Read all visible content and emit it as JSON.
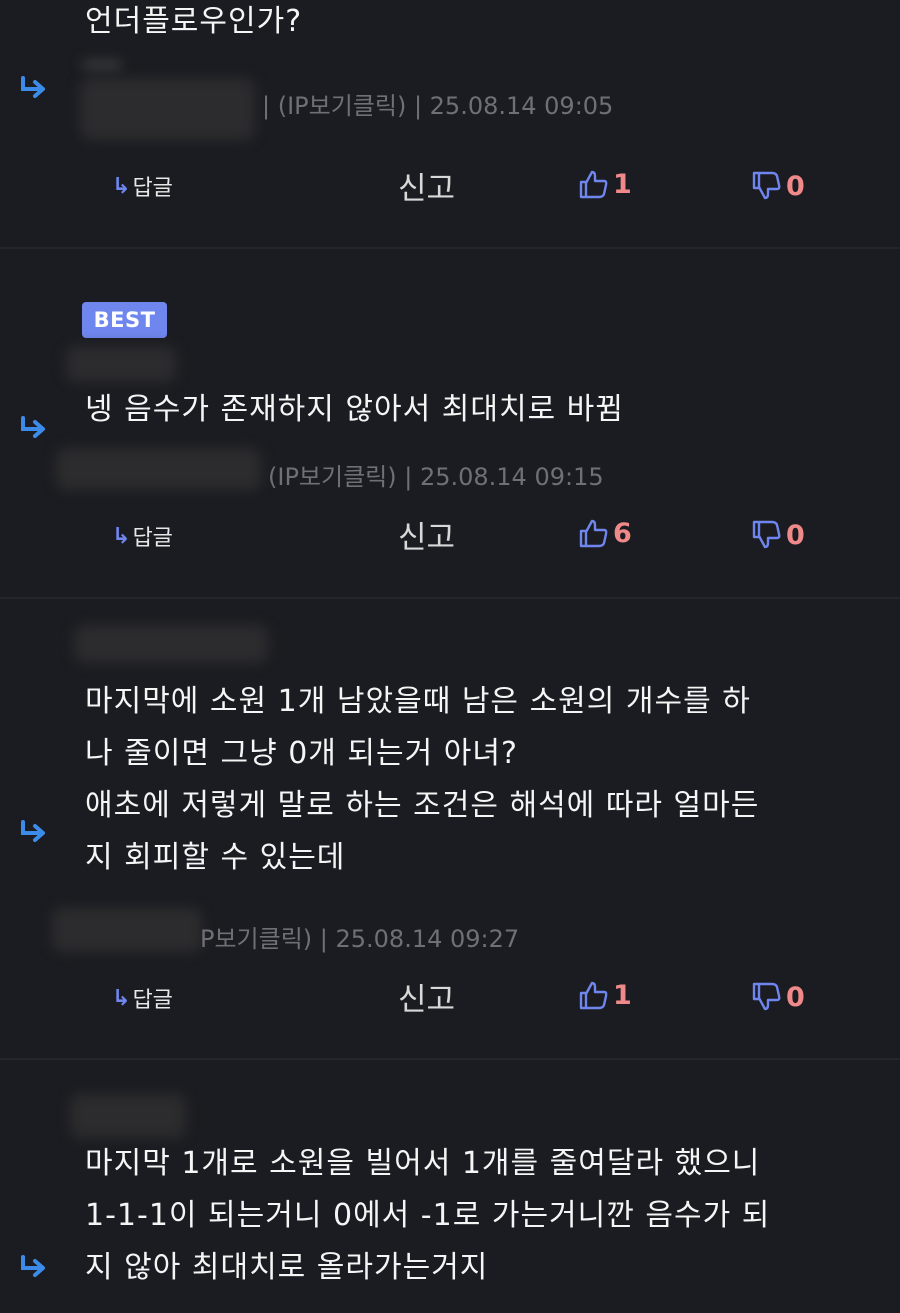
{
  "comments": [
    {
      "text": "언더플로우인가?",
      "meta": "| (IP보기클릭) | 25.08.14 09:05",
      "best": false,
      "reply_label": "답글",
      "report_label": "신고",
      "likes": "1",
      "dislikes": "0"
    },
    {
      "best_label": "BEST",
      "text": "넹 음수가 존재하지 않아서 최대치로 바뀜",
      "meta": "(IP보기클릭) | 25.08.14 09:15",
      "best": true,
      "reply_label": "답글",
      "report_label": "신고",
      "likes": "6",
      "dislikes": "0"
    },
    {
      "text": "마지막에 소원 1개 남았을때 남은 소원의 개수를 하\n나 줄이면 그냥 0개 되는거 아녀?\n애초에 저렇게 말로 하는 조건은 해석에 따라 얼마든\n지 회피할 수 있는데",
      "meta": "P보기클릭) | 25.08.14 09:27",
      "best": false,
      "reply_label": "답글",
      "report_label": "신고",
      "likes": "1",
      "dislikes": "0"
    },
    {
      "text": "마지막 1개로 소원을 빌어서 1개를 줄여달라 했으니\n1-1-1이 되는거니 0에서 -1로 가는거니깐 음수가 되\n지 않아 최대치로 올라가는거지",
      "best": false
    }
  ],
  "colors": {
    "background": "#1b1c21",
    "best_badge": "#6f86ee",
    "reply_arrow": "#3d8be8",
    "vote_count": "#f08a8a",
    "thumb_icon": "#6f86ee"
  },
  "icons": {
    "reply": "reply-arrow-icon",
    "like": "thumbs-up-icon",
    "dislike": "thumbs-down-icon"
  }
}
